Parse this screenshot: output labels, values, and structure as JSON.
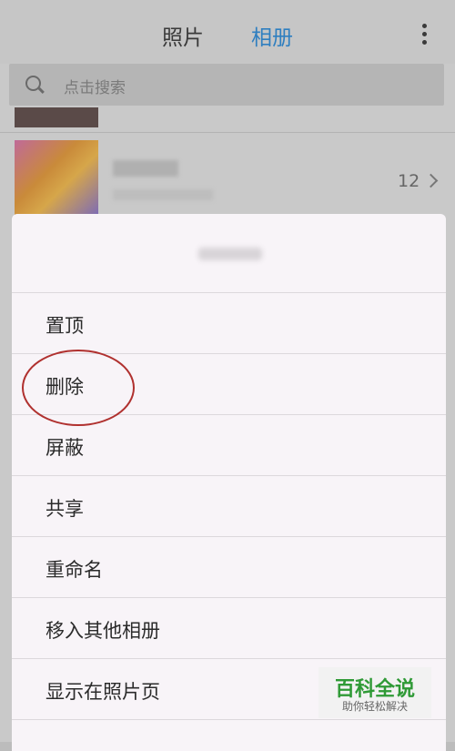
{
  "header": {
    "tabs": [
      {
        "label": "照片",
        "active": false
      },
      {
        "label": "相册",
        "active": true
      }
    ],
    "more_icon": "more-vertical-icon"
  },
  "search": {
    "placeholder": "点击搜索"
  },
  "album": {
    "count": "12"
  },
  "menu": {
    "items": [
      {
        "label": "置顶"
      },
      {
        "label": "删除"
      },
      {
        "label": "屏蔽"
      },
      {
        "label": "共享"
      },
      {
        "label": "重命名"
      },
      {
        "label": "移入其他相册"
      },
      {
        "label": "显示在照片页"
      }
    ]
  },
  "watermark": {
    "title": "百科全说",
    "subtitle": "助你轻松解决"
  },
  "colors": {
    "active_tab": "#2f7fc0",
    "annotation": "#b0312f",
    "watermark_green": "#2f9a36"
  }
}
